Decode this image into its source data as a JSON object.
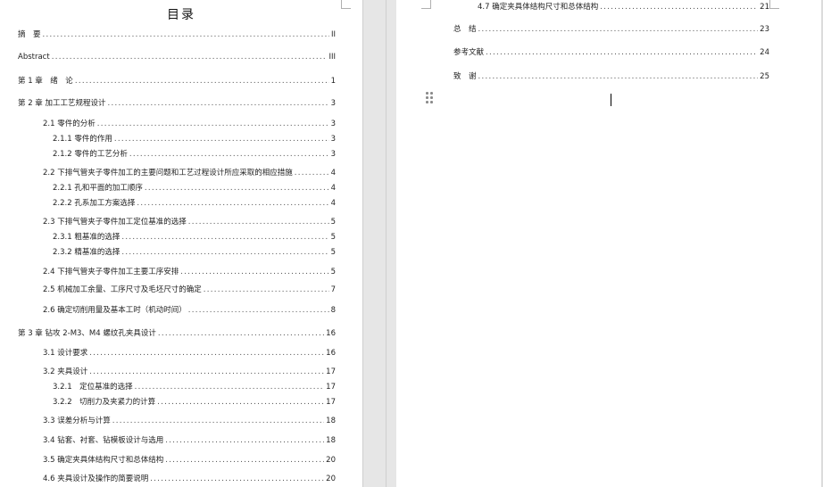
{
  "toc": {
    "title": "目录",
    "left_entries": [
      {
        "text": "摘　要",
        "page": "II"
      },
      {
        "text": "Abstract",
        "page": "III"
      },
      {
        "text": "第 1 章　绪　论",
        "page": "1"
      },
      {
        "text": "第 2 章 加工工艺规程设计",
        "page": "3"
      },
      {
        "text": "2.1 零件的分析",
        "page": "3"
      },
      {
        "text": "2.1.1 零件的作用",
        "page": "3"
      },
      {
        "text": "2.1.2 零件的工艺分析",
        "page": "3"
      },
      {
        "text": "2.2 下排气管夹子零件加工的主要问题和工艺过程设计所应采取的相应措施",
        "page": "4"
      },
      {
        "text": "2.2.1 孔和平面的加工顺序",
        "page": "4"
      },
      {
        "text": "2.2.2 孔系加工方案选择",
        "page": "4"
      },
      {
        "text": "2.3 下排气管夹子零件加工定位基准的选择",
        "page": "5"
      },
      {
        "text": "2.3.1 粗基准的选择",
        "page": "5"
      },
      {
        "text": "2.3.2 精基准的选择",
        "page": "5"
      },
      {
        "text": "2.4 下排气管夹子零件加工主要工序安排",
        "page": "5"
      },
      {
        "text": "2.5 机械加工余量、工序尺寸及毛坯尺寸的确定",
        "page": "7"
      },
      {
        "text": "2.6 确定切削用量及基本工时（机动时间）",
        "page": "8"
      },
      {
        "text": "第 3 章 钻攻 2-M3、M4 螺纹孔夹具设计",
        "page": "16"
      },
      {
        "text": "3.1 设计要求",
        "page": "16"
      },
      {
        "text": "3.2 夹具设计",
        "page": "17"
      },
      {
        "text": "3.2.1　定位基准的选择",
        "page": "17"
      },
      {
        "text": "3.2.2　切削力及夹紧力的计算",
        "page": "17"
      },
      {
        "text": "3.3 误差分析与计算",
        "page": "18"
      },
      {
        "text": "3.4 钻套、衬套、钻模板设计与选用",
        "page": "18"
      },
      {
        "text": "3.5 确定夹具体结构尺寸和总体结构",
        "page": "20"
      },
      {
        "text": "4.6 夹具设计及操作的简要说明",
        "page": "20"
      }
    ],
    "right_entries": [
      {
        "text": "4.7 确定夹具体结构尺寸和总体结构",
        "page": "21"
      },
      {
        "text": "总　结",
        "page": "23"
      },
      {
        "text": "参考文献",
        "page": "24"
      },
      {
        "text": "致　谢",
        "page": "25"
      }
    ]
  }
}
